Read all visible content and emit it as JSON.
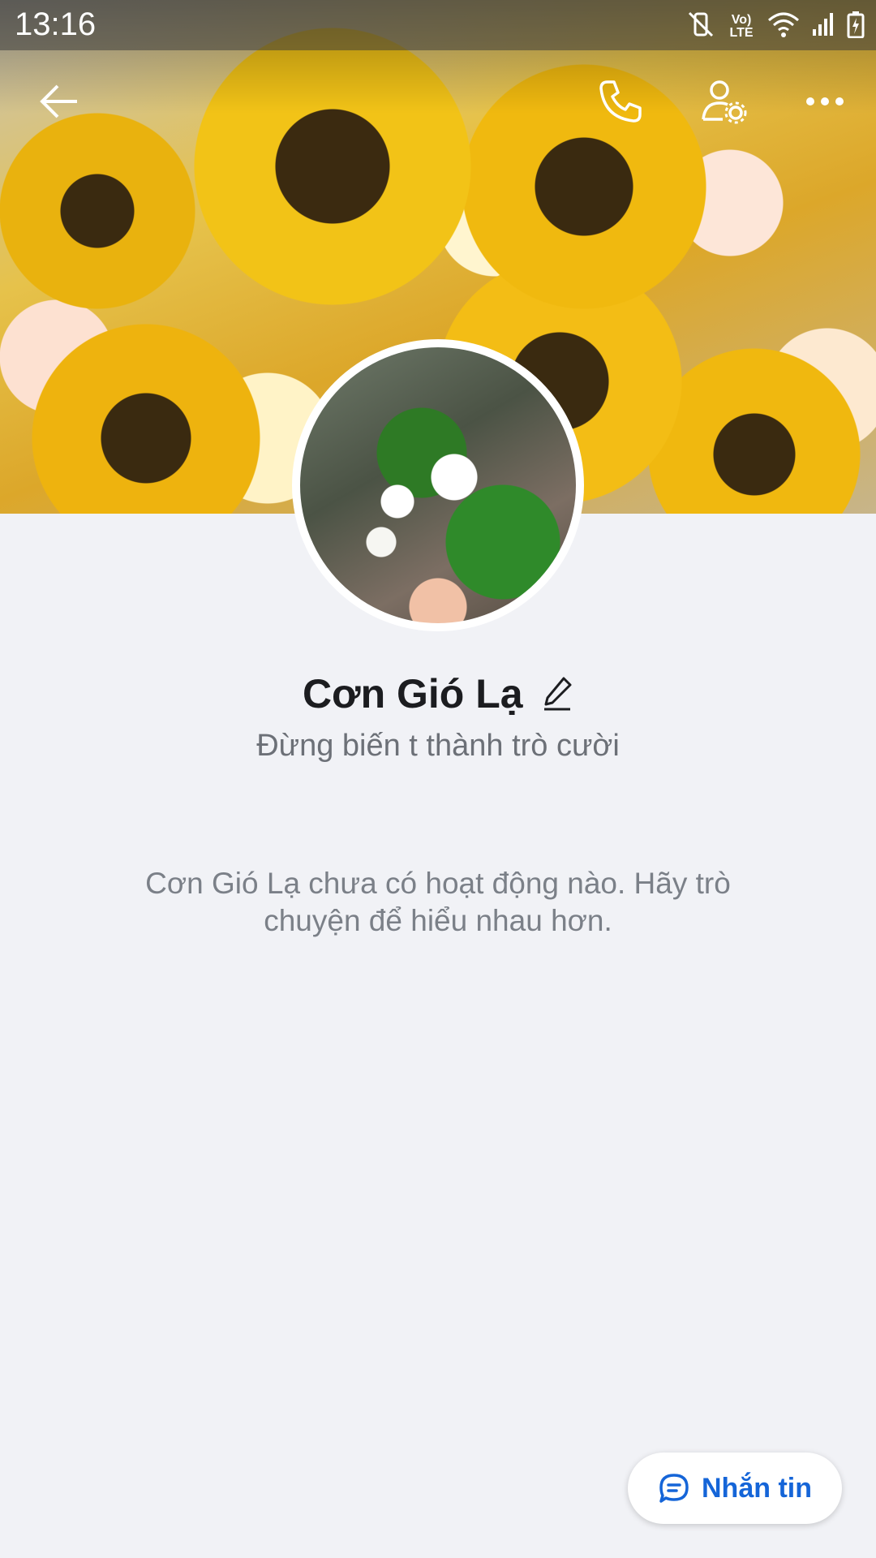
{
  "status_bar": {
    "time": "13:16",
    "network_label": "Vo) LTE"
  },
  "top_bar": {
    "back_icon": "arrow-left-icon",
    "call_icon": "phone-icon",
    "settings_icon": "user-settings-icon",
    "more_icon": "more-dots-icon"
  },
  "profile": {
    "name": "Cơn Gió Lạ",
    "bio": "Đừng biến t thành trò cười",
    "empty_activity": "Cơn Gió Lạ chưa có hoạt động nào. Hãy trò chuyện để hiểu nhau hơn."
  },
  "actions": {
    "message_label": "Nhắn tin",
    "message_icon": "chat-bubble-icon"
  },
  "colors": {
    "accent": "#1565d8",
    "background": "#f1f2f6"
  }
}
